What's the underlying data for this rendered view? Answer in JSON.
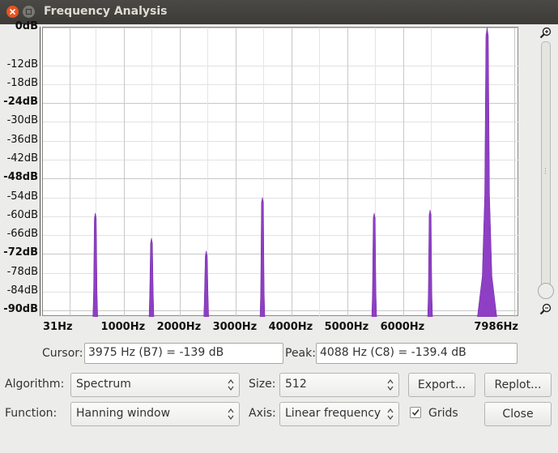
{
  "window": {
    "title": "Frequency Analysis"
  },
  "chart_data": {
    "type": "area",
    "ylim": [
      -91.5,
      0
    ],
    "yticks": [
      {
        "label": "0dB",
        "value": 0,
        "bold": true
      },
      {
        "label": "-12dB",
        "value": -12,
        "bold": false
      },
      {
        "label": "-18dB",
        "value": -18,
        "bold": false
      },
      {
        "label": "-24dB",
        "value": -24,
        "bold": true
      },
      {
        "label": "-30dB",
        "value": -30,
        "bold": false
      },
      {
        "label": "-36dB",
        "value": -36,
        "bold": false
      },
      {
        "label": "-42dB",
        "value": -42,
        "bold": false
      },
      {
        "label": "-48dB",
        "value": -48,
        "bold": true
      },
      {
        "label": "-54dB",
        "value": -54,
        "bold": false
      },
      {
        "label": "-60dB",
        "value": -60,
        "bold": false
      },
      {
        "label": "-66dB",
        "value": -66,
        "bold": false
      },
      {
        "label": "-72dB",
        "value": -72,
        "bold": true
      },
      {
        "label": "-78dB",
        "value": -78,
        "bold": false
      },
      {
        "label": "-84dB",
        "value": -84,
        "bold": false
      },
      {
        "label": "-90dB",
        "value": -90,
        "bold": true
      }
    ],
    "xlim": [
      31,
      7986
    ],
    "xticks": [
      {
        "label": "31Hz",
        "value": 31
      },
      {
        "label": "1000Hz",
        "value": 1000
      },
      {
        "label": "2000Hz",
        "value": 2000
      },
      {
        "label": "3000Hz",
        "value": 3000
      },
      {
        "label": "4000Hz",
        "value": 4000
      },
      {
        "label": "5000Hz",
        "value": 5000
      },
      {
        "label": "6000Hz",
        "value": 6000
      },
      {
        "label": "7986Hz",
        "value": 7986
      }
    ],
    "peaks": [
      {
        "freq": 490,
        "db": -59
      },
      {
        "freq": 1495,
        "db": -67
      },
      {
        "freq": 2475,
        "db": -71
      },
      {
        "freq": 3480,
        "db": -54
      },
      {
        "freq": 5480,
        "db": -59
      },
      {
        "freq": 6480,
        "db": -58
      },
      {
        "freq": 7500,
        "db": 0
      }
    ],
    "grid": true,
    "series_color": "#8e3fc4"
  },
  "cursor": {
    "label": "Cursor:",
    "value": "3975 Hz (B7) = -139 dB"
  },
  "peak": {
    "label": "Peak:",
    "value": "4088 Hz (C8) = -139.4 dB"
  },
  "algorithm": {
    "label": "Algorithm:",
    "value": "Spectrum"
  },
  "size": {
    "label": "Size:",
    "value": "512"
  },
  "function": {
    "label": "Function:",
    "value": "Hanning window"
  },
  "axis": {
    "label": "Axis:",
    "value": "Linear frequency"
  },
  "grids": {
    "label": "Grids",
    "checked": true
  },
  "buttons": {
    "export": "Export...",
    "replot": "Replot...",
    "close": "Close"
  },
  "colors": {
    "accent": "#e95420",
    "titlebar": "#3c3b37",
    "series": "#8e3fc4"
  }
}
